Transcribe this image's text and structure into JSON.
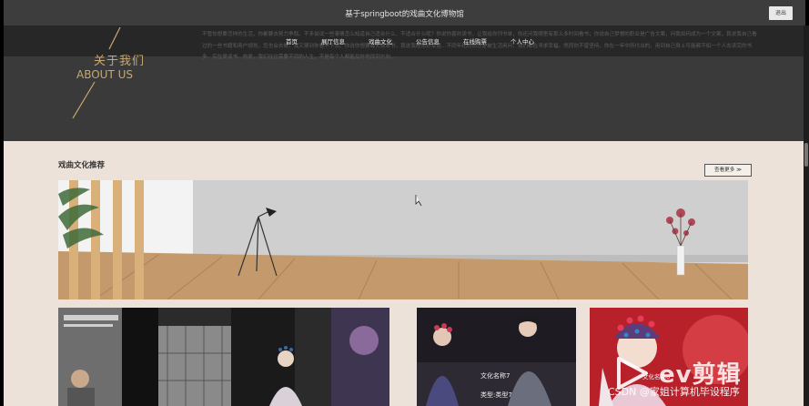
{
  "app": {
    "title": "基于springboot的戏曲文化博物馆",
    "logout_label": "退出"
  },
  "nav": {
    "items": [
      {
        "label": "首页"
      },
      {
        "label": "展厅信息"
      },
      {
        "label": "戏曲文化"
      },
      {
        "label": "公告信息"
      },
      {
        "label": "在线购票"
      },
      {
        "label": "个人中心"
      }
    ]
  },
  "about": {
    "title_cn": "关于我们",
    "title_en": "ABOUT US",
    "text": "不管你想要怎样的生活，你都要去努力争取。不多尝试一些事情怎么知道自己适合什么、不适合什么呢？你说你喜欢读书，让我给你列书单，你还问我哪里有那么多时间看书；你说自己梦想的职业是广告文案，问我如何成为一个文案，我说我自己看过的一些书籍和用户规划，您也会去做，我又猜到你看不下去。你说你想要每天读本书，我说我经常好幸运…不同年纪的你总是被生活用问，我们都在寻求幸福。然而你不曾坚持，你在一年中所付出的，用到自己身上可能都不如一个人去读完的书多。实在爱读书、热爱，我们往往需要不同的人生，不是每个人都能及时地找到方向…"
  },
  "section": {
    "title": "戏曲文化推荐",
    "more_label": "查看更多 ≫"
  },
  "cards": [
    {
      "name": "",
      "type": ""
    },
    {
      "name": "文化名称7",
      "type": "类型:类型7"
    },
    {
      "name": "文化名称6",
      "type": ""
    }
  ],
  "watermark": {
    "ev": "ev剪辑",
    "csdn": "CSDN @家姐计算机毕设程序"
  },
  "colors": {
    "accent_gold": "#c7a86f",
    "page_bg": "#ece2d9",
    "header_dark": "#3a3a3a"
  }
}
